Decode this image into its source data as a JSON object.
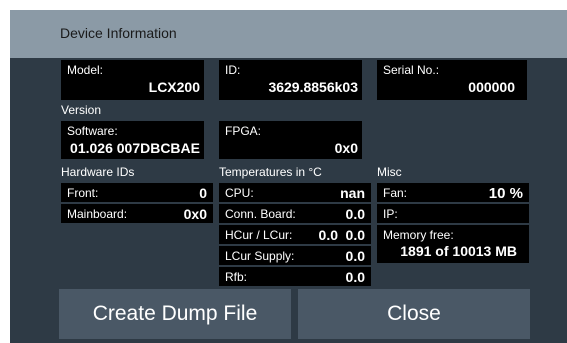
{
  "dialog": {
    "title": "Device Information"
  },
  "model": {
    "label": "Model:",
    "value": "LCX200"
  },
  "id": {
    "label": "ID:",
    "value": "3629.8856k03"
  },
  "serial": {
    "label": "Serial No.:",
    "value": "000000"
  },
  "version": {
    "heading": "Version"
  },
  "software": {
    "label": "Software:",
    "value": "01.026 007DBCBAE"
  },
  "fpga": {
    "label": "FPGA:",
    "value": "0x0"
  },
  "hardware_ids": {
    "heading": "Hardware IDs",
    "rows": [
      {
        "label": "Front:",
        "value": "0"
      },
      {
        "label": "Mainboard:",
        "value": "0x0"
      }
    ]
  },
  "temperatures": {
    "heading": "Temperatures in °C",
    "cpu": {
      "label": "CPU:",
      "value": "nan"
    },
    "conn_board": {
      "label": "Conn. Board:",
      "value": "0.0"
    },
    "hcur_lcur": {
      "label": "HCur / LCur:",
      "value1": "0.0",
      "value2": "0.0"
    },
    "lcur_supply": {
      "label": "LCur Supply:",
      "value": "0.0"
    },
    "rfb": {
      "label": "Rfb:",
      "value": "0.0"
    }
  },
  "misc": {
    "heading": "Misc",
    "fan": {
      "label": "Fan:",
      "value": "10 %"
    },
    "ip": {
      "label": "IP:",
      "value": ""
    },
    "memory": {
      "label": "Memory free:",
      "value": "1891 of 10013 MB"
    }
  },
  "buttons": {
    "dump": "Create Dump File",
    "close": "Close"
  }
}
